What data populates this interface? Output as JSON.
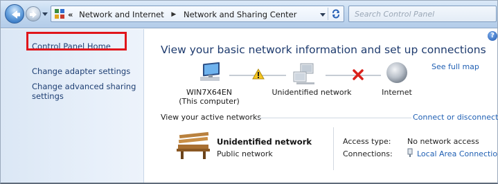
{
  "navigation": {
    "back_icon": "back-arrow-icon",
    "forward_icon": "forward-arrow-icon"
  },
  "address_bar": {
    "overflow_chevron": "«",
    "crumbs": [
      "Network and Internet",
      "Network and Sharing Center"
    ],
    "separator": "▶",
    "refresh_icon": "refresh-icon"
  },
  "search": {
    "placeholder": "Search Control Panel"
  },
  "sidebar": {
    "items": [
      {
        "label": "Control Panel Home"
      },
      {
        "label": "Change adapter settings"
      },
      {
        "label": "Change advanced sharing settings"
      }
    ]
  },
  "main": {
    "title": "View your basic network information and set up connections",
    "help": "?",
    "see_full_map": "See full map",
    "map_nodes": [
      {
        "label": "WIN7X64EN",
        "sublabel": "(This computer)",
        "icon": "computer-icon"
      },
      {
        "label": "Unidentified network",
        "icon": "warning-icon"
      },
      {
        "label": "Internet",
        "icon": "globe-icon"
      }
    ],
    "link_status_icons": [
      "warning-icon",
      "red-x-icon"
    ],
    "active_networks_header": "View your active networks",
    "connect_link": "Connect or disconnect",
    "network": {
      "name": "Unidentified network",
      "category": "Public network",
      "icon": "park-bench-icon",
      "access_type_label": "Access type:",
      "access_type_value": "No network access",
      "connections_label": "Connections:",
      "connections_value": "Local Area Connection",
      "connection_icon": "network-adapter-icon"
    }
  },
  "colors": {
    "link": "#1f5fb3",
    "title": "#1e3b6e",
    "highlight": "#e0151b",
    "sidebar_bg": "#dbe7f5"
  }
}
